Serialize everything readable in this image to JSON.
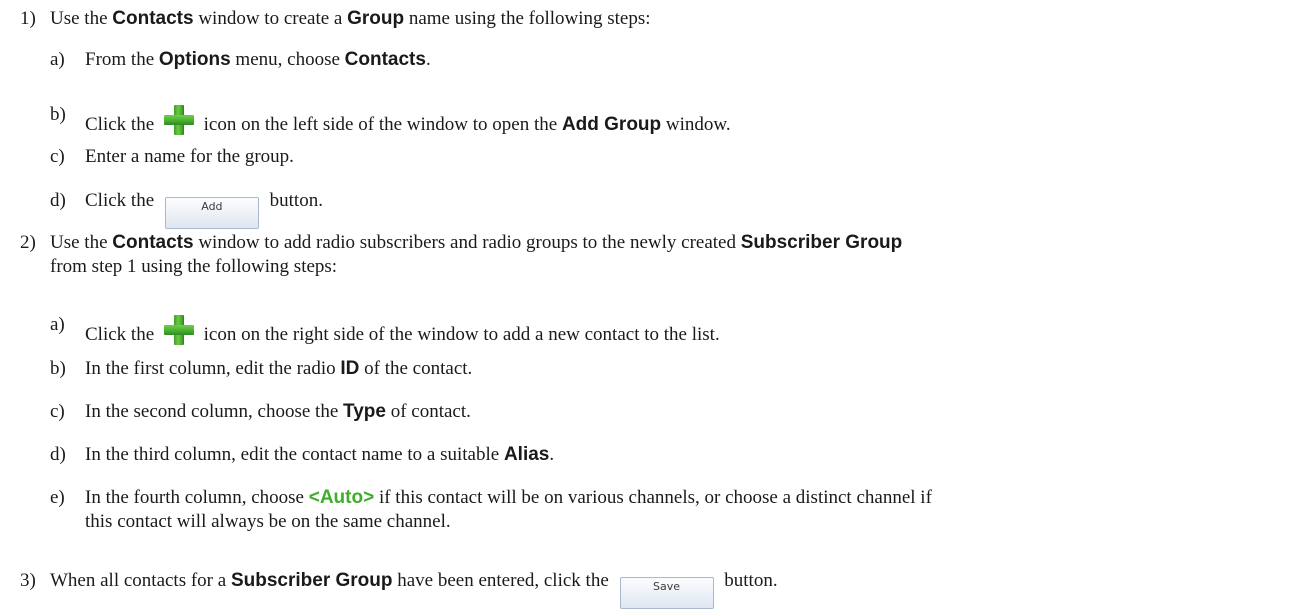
{
  "steps": [
    {
      "num": "1)",
      "text": {
        "pre": "Use the ",
        "b1": "Contacts",
        "mid": " window to create a ",
        "b2": "Group",
        "post": " name using the following steps:"
      },
      "substeps": [
        {
          "num": "a)",
          "pre": "From the ",
          "b1": "Options",
          "mid": " menu, choose ",
          "b2": "Contacts",
          "post": "."
        },
        {
          "num": "b)",
          "pre": "Click the ",
          "icon": "green-plus-icon",
          "mid": " icon on the left side of the window to open the ",
          "b1": "Add Group",
          "post": " window."
        },
        {
          "num": "c)",
          "text": "Enter a name for the group."
        },
        {
          "num": "d)",
          "pre": "Click the ",
          "button_label": "Add",
          "post": " button."
        }
      ]
    },
    {
      "num": "2)",
      "text": {
        "pre": "Use the ",
        "b1": "Contacts",
        "mid": " window to add radio subscribers and radio groups to the newly created ",
        "b2": "Subscriber Group",
        "line2": "from step 1 using the following steps:"
      },
      "substeps": [
        {
          "num": "a)",
          "pre": "Click the ",
          "icon": "green-plus-icon",
          "post": " icon on the right side of the window to add a new contact to the list."
        },
        {
          "num": "b)",
          "pre": "In the first column, edit the radio ",
          "b1": "ID",
          "post": " of the contact."
        },
        {
          "num": "c)",
          "pre": "In the second column, choose the ",
          "b1": "Type",
          "post": " of contact."
        },
        {
          "num": "d)",
          "pre": "In the third column, edit the contact name to a suitable ",
          "b1": "Alias",
          "post": "."
        },
        {
          "num": "e)",
          "pre": "In the fourth column, choose ",
          "g1": "<Auto>",
          "post": " if this contact will be on various channels, or choose a distinct channel if",
          "line2": "this contact will always be on the same channel."
        }
      ]
    },
    {
      "num": "3)",
      "text": {
        "pre": "When all contacts for a ",
        "b1": "Subscriber Group",
        "mid": " have been entered, click the ",
        "button_label": "Save",
        "post": " button."
      }
    }
  ],
  "colors": {
    "auto_green": "#3fae2a",
    "plus_icon_green": "#4fb233"
  }
}
